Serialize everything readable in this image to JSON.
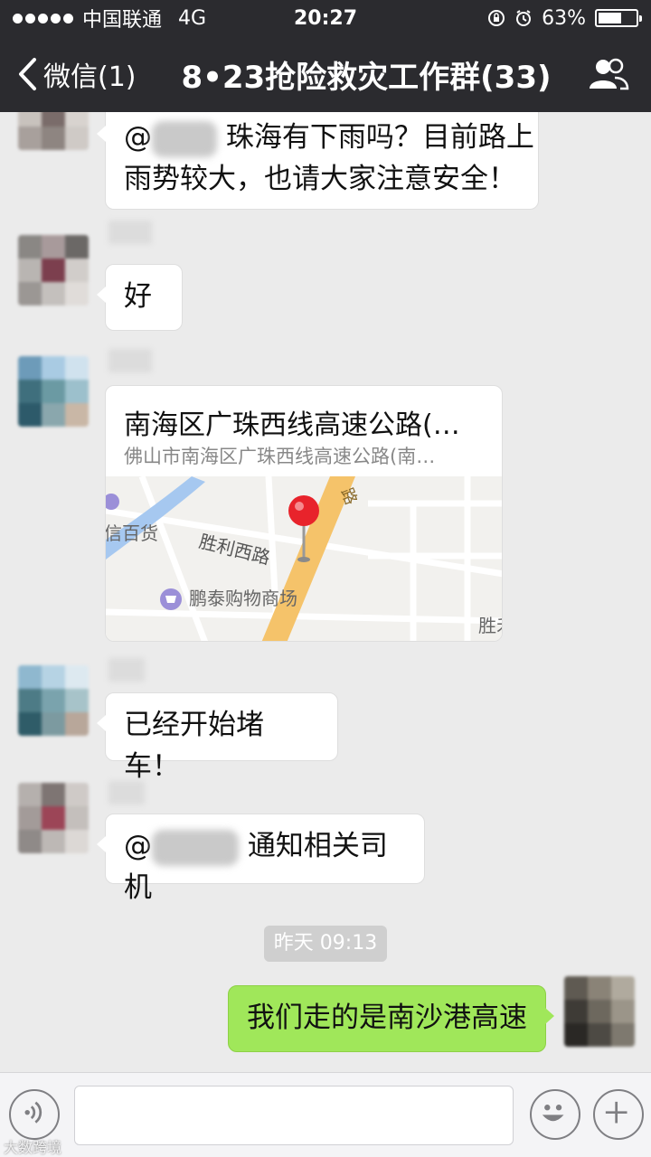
{
  "status_bar": {
    "carrier": "中国联通",
    "network": "4G",
    "time": "20:27",
    "battery": "63%",
    "battery_level": 0.63
  },
  "nav": {
    "back_label": "微信(1)",
    "title": "8•23抢险救灾工作群(33)"
  },
  "messages": {
    "m1_text": "珠海有下雨吗？目前路上",
    "m1_text2": "雨势较大，也请大家注意安全！",
    "m1_prefix": "@",
    "m2_text": "好",
    "location": {
      "title": "南海区广珠西线高速公路(…",
      "address": "佛山市南海区广珠西线高速公路(南…",
      "map_labels": {
        "store": "信百货",
        "road": "胜利西路",
        "mall": "鹏泰购物商场",
        "corner": "胜禾",
        "road_top": "路"
      }
    },
    "m4_text": "已经开始堵车！",
    "m5_prefix": "@",
    "m5_text": "通知相关司机",
    "timestamp": "昨天 09:13",
    "m6_text": "我们走的是南沙港高速"
  },
  "input": {
    "placeholder": ""
  },
  "watermark": "大数跨境",
  "colors": {
    "header_bg": "#2b2b2f",
    "chat_bg": "#ebebeb",
    "self_bubble": "#a0e75a",
    "map_road": "#f5c36a",
    "pin": "#e8232b"
  }
}
